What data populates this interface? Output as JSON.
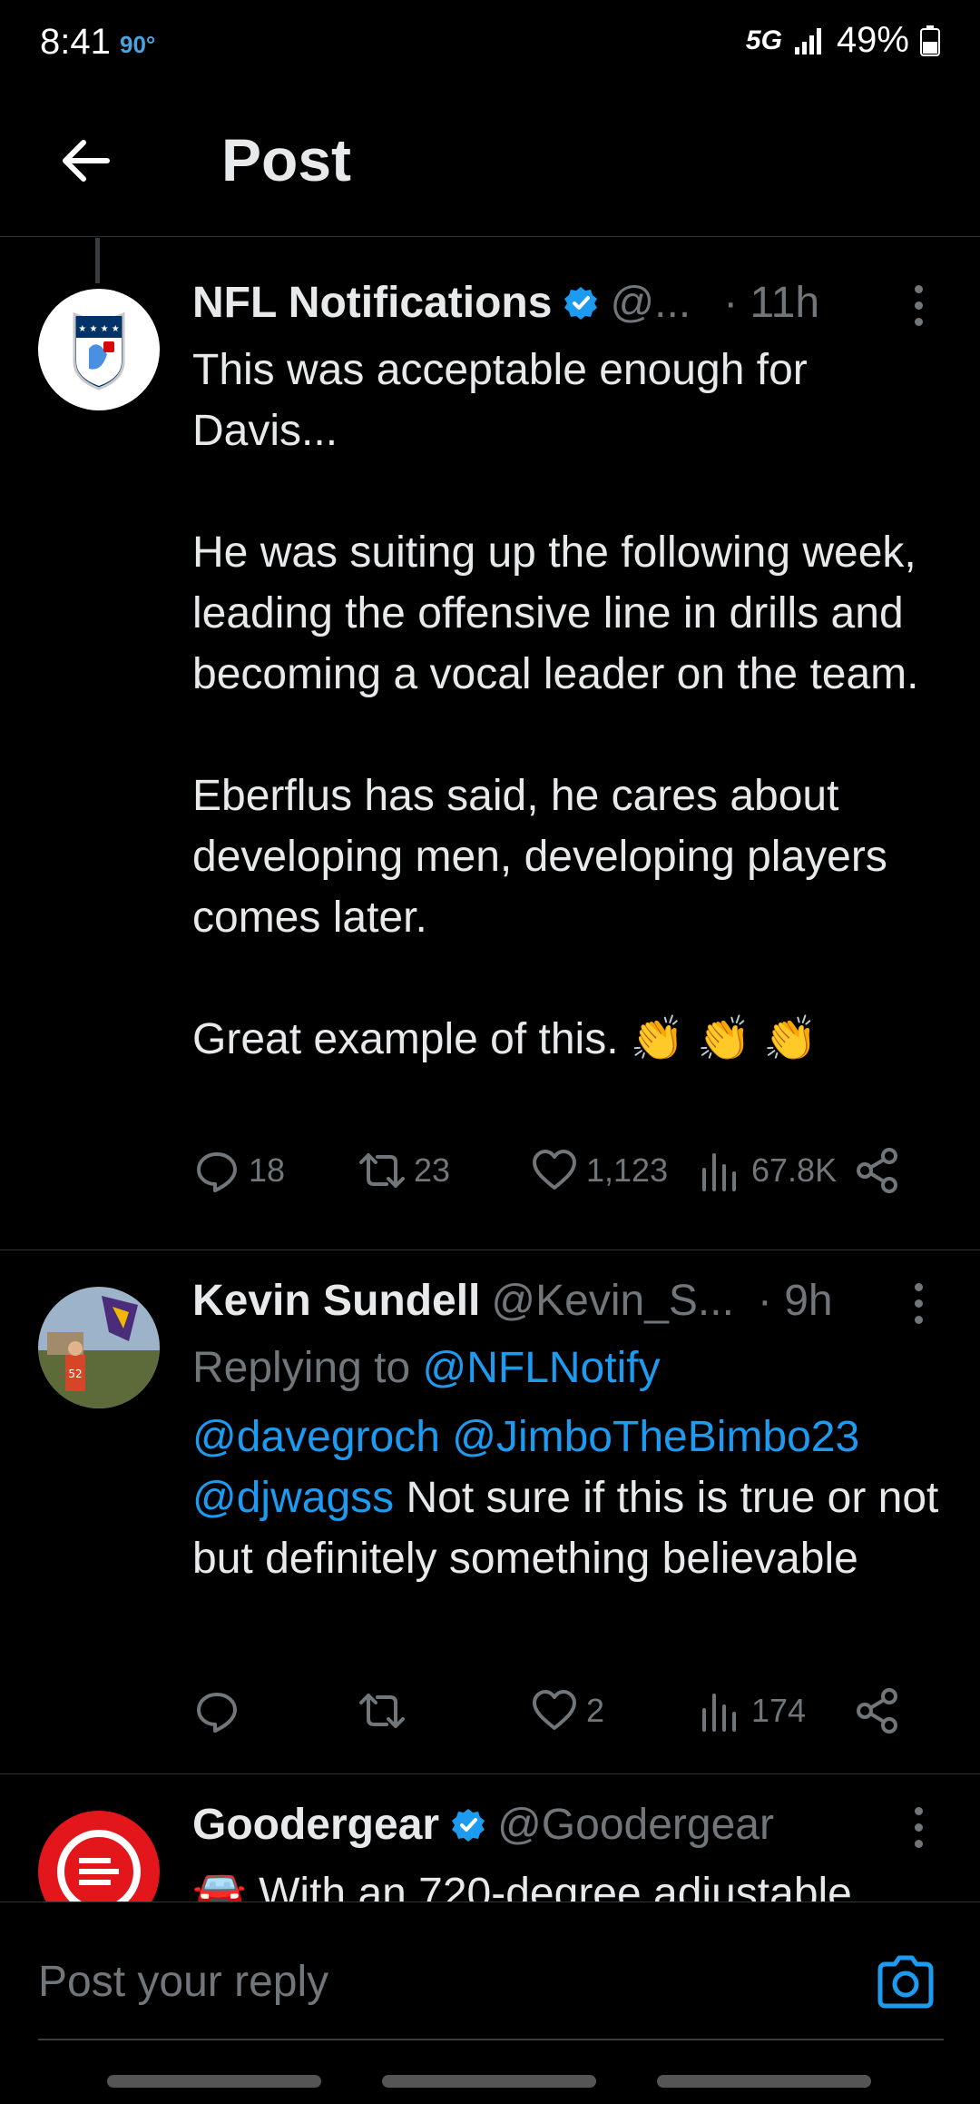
{
  "status_bar": {
    "time": "8:41",
    "temperature": "90°",
    "network": "5G",
    "battery": "49%"
  },
  "header": {
    "title": "Post"
  },
  "posts": [
    {
      "display_name": "NFL Notifications",
      "handle": "@...",
      "time": "· 11h",
      "verified": true,
      "paragraphs": [
        "This was acceptable enough for Davis...",
        "He was suiting up the following week, leading the offensive line in drills and becoming a vocal leader on the team.",
        "Eberflus has said, he cares about developing men, developing players comes later.",
        "Great example of this. 👏 👏 👏"
      ],
      "stats": {
        "replies": "18",
        "reposts": "23",
        "likes": "1,123",
        "views": "67.8K"
      }
    },
    {
      "display_name": "Kevin Sundell",
      "handle": "@Kevin_S...",
      "time": "· 9h",
      "verified": false,
      "replying_to_prefix": "Replying to",
      "replying_to": "@NFLNotify",
      "mentions": [
        "@davegroch",
        "@JimboTheBimbo23",
        "@djwagss"
      ],
      "text": "Not sure if this is true or not but definitely something believable",
      "stats": {
        "replies": "",
        "reposts": "",
        "likes": "2",
        "views": "174"
      }
    },
    {
      "display_name": "Goodergear",
      "handle": "@Goodergear",
      "verified": true,
      "text": "🚘 With an 720-degree adjustable"
    }
  ],
  "reply_bar": {
    "placeholder": "Post your reply"
  },
  "colors": {
    "background": "#000000",
    "text": "#e7e9ea",
    "muted": "#71767b",
    "link": "#1d9bf0",
    "divider": "#2f3336"
  }
}
